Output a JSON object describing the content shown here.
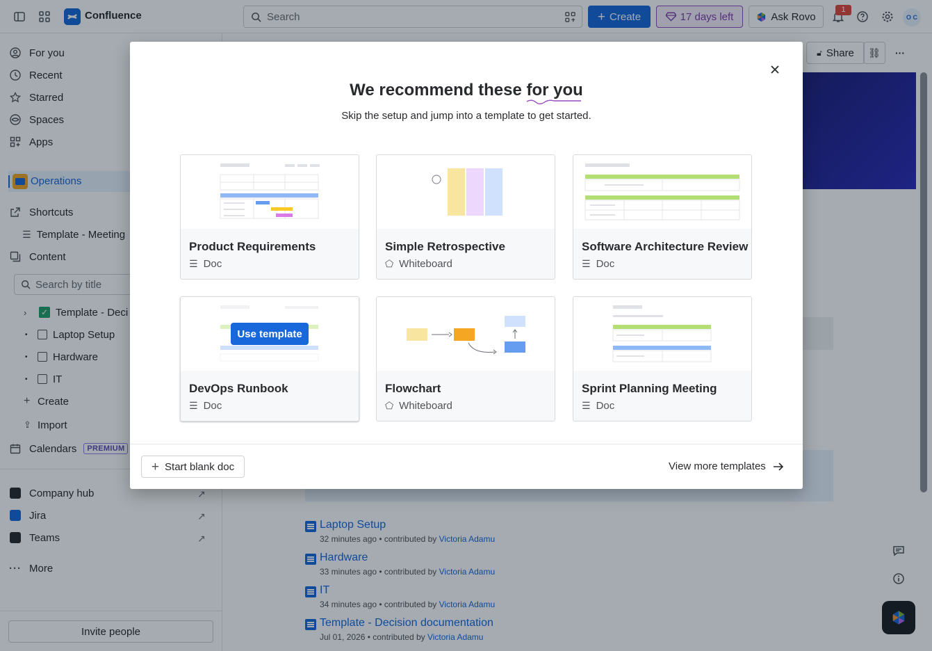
{
  "topbar": {
    "app_name": "Confluence",
    "search_placeholder": "Search",
    "create_label": "Create",
    "trial_label": "17 days left",
    "rovo_label": "Ask Rovo",
    "notification_count": "1",
    "avatar_initials": "O C"
  },
  "sidebar": {
    "nav": [
      "For you",
      "Recent",
      "Starred",
      "Spaces",
      "Apps"
    ],
    "space_name": "Operations",
    "shortcuts_label": "Shortcuts",
    "shortcut_item": "Template - Meeting",
    "content_label": "Content",
    "search_placeholder": "Search by title",
    "tree": [
      "Template - Deci",
      "Laptop Setup",
      "Hardware",
      "IT"
    ],
    "create_label": "Create",
    "import_label": "Import",
    "calendars_label": "Calendars",
    "premium_badge": "PREMIUM",
    "apps": [
      "Company hub",
      "Jira",
      "Teams"
    ],
    "more_label": "More",
    "invite_label": "Invite people"
  },
  "page": {
    "share_label": "Share",
    "recent": [
      {
        "title": "Laptop Setup",
        "meta": "32 minutes ago • contributed by ",
        "who": "Victoria Adamu"
      },
      {
        "title": "Hardware",
        "meta": "33 minutes ago • contributed by ",
        "who": "Victoria Adamu"
      },
      {
        "title": "IT",
        "meta": "34 minutes ago • contributed by ",
        "who": "Victoria Adamu"
      },
      {
        "title": "Template - Decision documentation",
        "meta": "Jul 01, 2026 • contributed by ",
        "who": "Victoria Adamu"
      }
    ]
  },
  "modal": {
    "title_prefix": "We recommend these ",
    "title_highlight": "for you",
    "subtitle": "Skip the setup and jump into a template to get started.",
    "use_template_label": "Use template",
    "templates": [
      {
        "name": "Product Requirements",
        "type": "Doc",
        "icon": "doc-icon"
      },
      {
        "name": "Simple Retrospective",
        "type": "Whiteboard",
        "icon": "whiteboard-icon"
      },
      {
        "name": "Software Architecture Review",
        "type": "Doc",
        "icon": "doc-icon"
      },
      {
        "name": "DevOps Runbook",
        "type": "Doc",
        "icon": "doc-icon"
      },
      {
        "name": "Flowchart",
        "type": "Whiteboard",
        "icon": "whiteboard-icon"
      },
      {
        "name": "Sprint Planning Meeting",
        "type": "Doc",
        "icon": "doc-icon"
      }
    ],
    "blank_label": "Start blank doc",
    "more_label": "View more templates"
  },
  "colors": {
    "brand": "#1868db",
    "trial_purple": "#964ac0",
    "overlay": "rgba(5,21,36,0.36)"
  }
}
